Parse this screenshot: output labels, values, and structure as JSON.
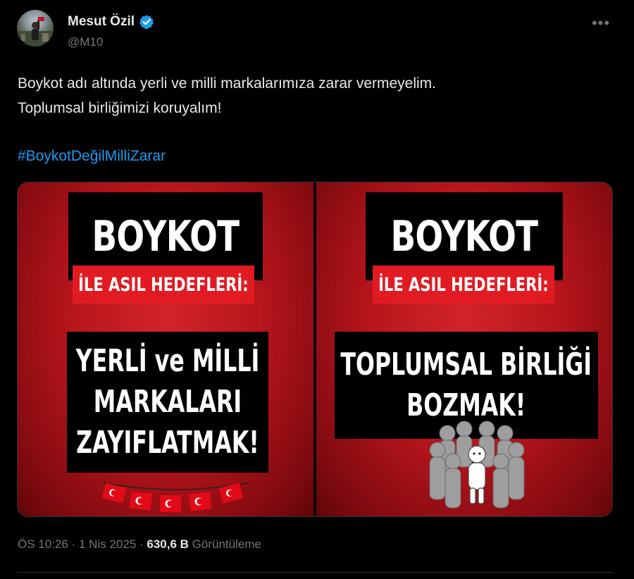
{
  "author": {
    "display_name": "Mesut Özil",
    "handle": "@M10",
    "verified": true,
    "avatar_icon": "profile-photo"
  },
  "tweet": {
    "lines": [
      "Boykot adı altında yerli ve milli markalarımıza zarar vermeyelim.",
      "Toplumsal birliğimizi koruyalım!"
    ],
    "hashtag": "#BoykotDeğilMilliZarar"
  },
  "media": {
    "left": {
      "title": "BOYKOT",
      "subtitle": "İLE ASIL HEDEFLERİ:",
      "body": [
        "YERLİ ve MİLLİ",
        "MARKALARI",
        "ZAYIFLATMAK!"
      ]
    },
    "right": {
      "title": "BOYKOT",
      "subtitle": "İLE ASIL HEDEFLERİ:",
      "body": [
        "TOPLUMSAL BİRLİĞİ",
        "BOZMAK!"
      ]
    }
  },
  "meta": {
    "time": "ÖS 10:26",
    "separator": "·",
    "date": "1 Nis 2025",
    "views_count": "630,6 B",
    "views_label": "Görüntüleme"
  },
  "colors": {
    "background": "#000000",
    "text": "#e7e9ea",
    "muted": "#71767b",
    "link": "#1d9bf0",
    "verified": "#1d9bf0",
    "poster_red": "#e21b23"
  }
}
